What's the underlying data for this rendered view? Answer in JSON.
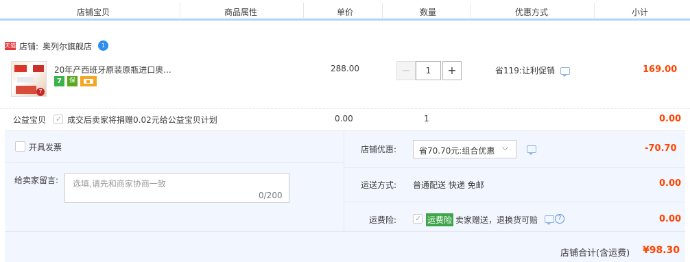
{
  "header": {
    "col_item": "店铺宝贝",
    "col_attr": "商品属性",
    "col_price": "单价",
    "col_qty": "数量",
    "col_promo": "优惠方式",
    "col_subtotal": "小计"
  },
  "shop": {
    "badge": "天猫",
    "label": "店铺:",
    "name": "奥列尔旗舰店",
    "chat_badge": "1"
  },
  "item": {
    "title": "20年产西班牙原装原瓶进口奥...",
    "price": "288.00",
    "quantity": "1",
    "minus": "−",
    "plus": "+",
    "promo": "省119:让利促销",
    "subtotal": "169.00",
    "service_badge_1": "7",
    "service_badge_2": "保",
    "thumb_text": "7"
  },
  "charity": {
    "label": "公益宝贝",
    "text": "成交后卖家将捐赠0.02元给公益宝贝计划",
    "price": "0.00",
    "quantity": "1",
    "subtotal": "0.00"
  },
  "invoice": {
    "label": "开具发票"
  },
  "message": {
    "label": "给卖家留言:",
    "placeholder": "选填,请先和商家协商一致",
    "counter": "0/200"
  },
  "shop_discount": {
    "label": "店铺优惠:",
    "selected": "省70.70元:组合优惠",
    "amount": "-70.70"
  },
  "shipping": {
    "label": "运送方式:",
    "value": "普通配送 快递 免邮",
    "amount": "0.00"
  },
  "insurance": {
    "label": "运费险:",
    "badge": "运费险",
    "text": "卖家赠送，退换货可赔",
    "amount": "0.00"
  },
  "total": {
    "label": "店铺合计(含运费)",
    "amount": "¥98.30"
  },
  "colors": {
    "header_border": "#b2d1ff",
    "price_red": "#ff4400",
    "panel_bg": "#f2f7ff",
    "insurance_green": "#3fa54a"
  }
}
